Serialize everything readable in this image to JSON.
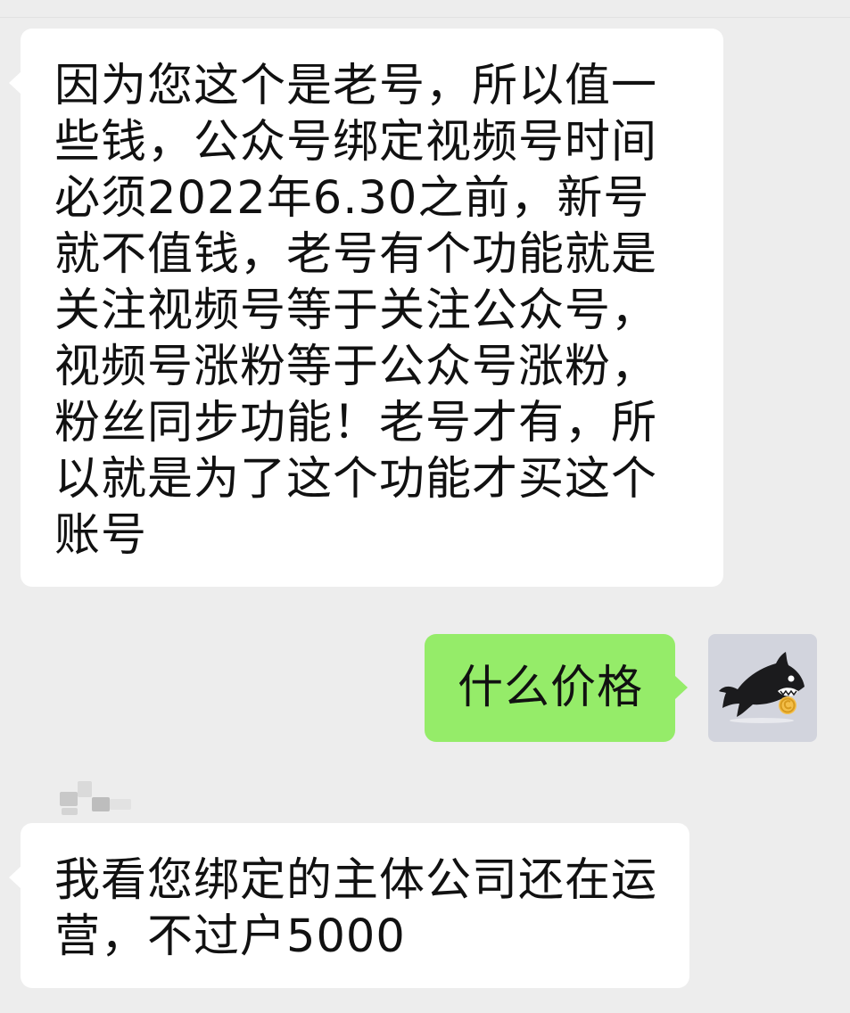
{
  "chat": {
    "messages": [
      {
        "direction": "incoming",
        "text": "因为您这个是老号，所以值一些钱，公众号绑定视频号时间必须2022年6.30之前，新号就不值钱，老号有个功能就是关注视频号等于关注公众号，视频号涨粉等于公众号涨粉，粉丝同步功能！老号才有，所以就是为了这个功能才买这个账号"
      },
      {
        "direction": "outgoing",
        "text": "什么价格"
      },
      {
        "direction": "incoming",
        "text": "我看您绑定的主体公司还在运营，不过户5000"
      }
    ],
    "self_avatar": {
      "icon": "shark-with-coin-icon"
    },
    "sender_name_redacted": true
  },
  "colors": {
    "background": "#ededed",
    "incoming_bubble": "#ffffff",
    "outgoing_bubble": "#95ec69",
    "text": "#111111"
  }
}
